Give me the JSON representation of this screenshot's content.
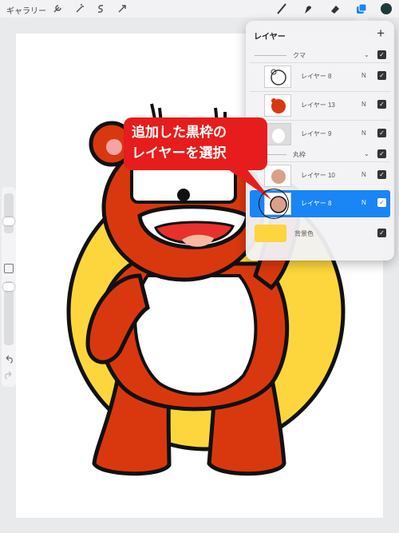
{
  "toolbar": {
    "gallery": "ギャラリー",
    "left_icons": [
      "wrench-icon",
      "magic-wand-icon",
      "selection-icon",
      "arrow-icon"
    ],
    "right_icons": [
      "brush-icon",
      "smudge-icon",
      "eraser-icon",
      "layers-icon",
      "color-icon"
    ],
    "accent_color": "#1a85f5"
  },
  "layers_panel": {
    "title": "レイヤー",
    "add": "+",
    "groups": [
      {
        "name": "クマ",
        "layers": [
          {
            "name": "レイヤー 8",
            "blend": "N"
          },
          {
            "name": "レイヤー 13",
            "blend": "N"
          },
          {
            "name": "レイヤー 9",
            "blend": "N"
          }
        ]
      },
      {
        "name": "丸枠",
        "layers": [
          {
            "name": "レイヤー 10",
            "blend": "N"
          },
          {
            "name": "レイヤー 8",
            "blend": "N",
            "selected": true
          }
        ]
      }
    ],
    "background": {
      "name": "背景色",
      "color": "#fcd63c"
    }
  },
  "callout": {
    "line1": "追加した黒枠の",
    "line2": "レイヤーを選択",
    "color": "#e71c1c"
  },
  "colors": {
    "bear_body": "#d9380f",
    "bear_belly": "#ffffff",
    "background_circle": "#fcd63c",
    "outline": "#111111"
  }
}
